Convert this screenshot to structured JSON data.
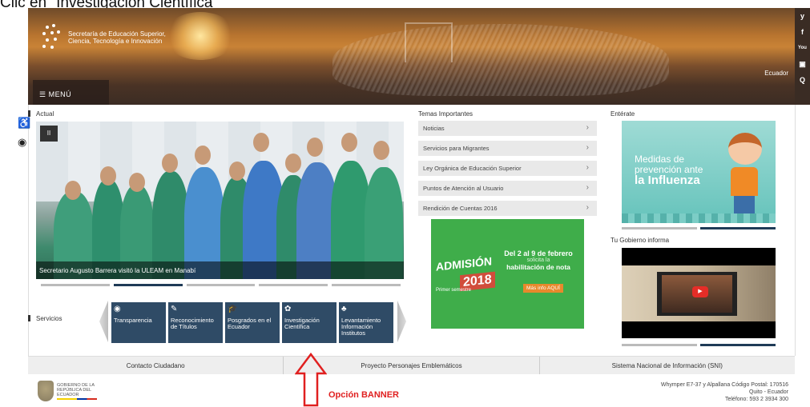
{
  "caption": "Clic en \"Investigación Científica\"",
  "header": {
    "logo_text": "Secretaría de Educación Superior, Ciencia, Tecnología e Innovación",
    "menu_label": "MENÚ",
    "country": "Ecuador"
  },
  "social": [
    "y",
    "f",
    "You",
    "▣",
    "Q"
  ],
  "accessibility": {
    "person_icon": "accessibility-person-icon",
    "eye_icon": "eye-icon"
  },
  "actual": {
    "label": "Actual",
    "pause_symbol": "II",
    "caption": "Secretario Augusto Barrera visitó la ULEAM en Manabí",
    "dots": 5,
    "active_dot": 1
  },
  "servicios": {
    "label": "Servicios",
    "items": [
      {
        "icon": "eye-icon",
        "glyph": "◉",
        "label": "Transparencia"
      },
      {
        "icon": "edit-icon",
        "glyph": "✎",
        "label": "Reconocimiento de Títulos"
      },
      {
        "icon": "graduation-cap-icon",
        "glyph": "🎓",
        "label": "Posgrados en el Ecuador"
      },
      {
        "icon": "gear-icon",
        "glyph": "✿",
        "label": "Investigación Científica"
      },
      {
        "icon": "institution-icon",
        "glyph": "♣",
        "label": "Levantamiento Información Institutos"
      }
    ]
  },
  "temas": {
    "label": "Temas Importantes",
    "items": [
      "Noticias",
      "Servicios para Migrantes",
      "Ley Orgánica de Educación Superior",
      "Puntos de Atención al Usuario",
      "Rendición de Cuentas 2016"
    ]
  },
  "admision": {
    "title": "ADMISIÓN",
    "year": "2018",
    "sub": "Primer semestre",
    "line1": "Del 2 al 9 de febrero",
    "line2": "solicita la",
    "line3": "habilitación de nota",
    "button": "Más info AQUÍ"
  },
  "enterate": {
    "label": "Entérate",
    "line1": "Medidas de",
    "line2": "prevención ante",
    "line3": "la Influenza"
  },
  "gobierno_informa": {
    "label": "Tu Gobierno informa"
  },
  "footer": {
    "links": [
      "Contacto Ciudadano",
      "Proyecto Personajes Emblemáticos",
      "Sistema Nacional de Información (SNI)"
    ],
    "gov_logo_text": "GOBIERNO DE LA REPÚBLICA DEL ECUADOR",
    "address_1": "Whymper E7-37 y Alpallana Código Postal: 170516",
    "address_2": "Quito - Ecuador",
    "address_3": "Teléfono: 593 2 3934 300"
  },
  "annotation": {
    "label": "Opción BANNER",
    "color": "#e02020"
  }
}
